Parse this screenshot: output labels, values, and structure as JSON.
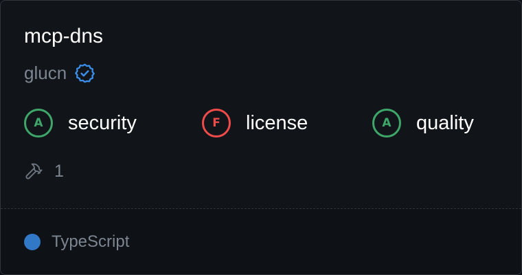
{
  "server": {
    "name": "mcp-dns",
    "owner": "glucn",
    "verified": true
  },
  "grades": [
    {
      "grade": "A",
      "label": "security",
      "color": "#3fa66a"
    },
    {
      "grade": "F",
      "label": "license",
      "color": "#ef4b4b"
    },
    {
      "grade": "A",
      "label": "quality",
      "color": "#3fa66a"
    }
  ],
  "tools": {
    "icon": "hammer-icon",
    "count": "1"
  },
  "language": {
    "name": "TypeScript",
    "color": "#3178c6"
  },
  "colors": {
    "verified_badge": "#3b8eea"
  }
}
